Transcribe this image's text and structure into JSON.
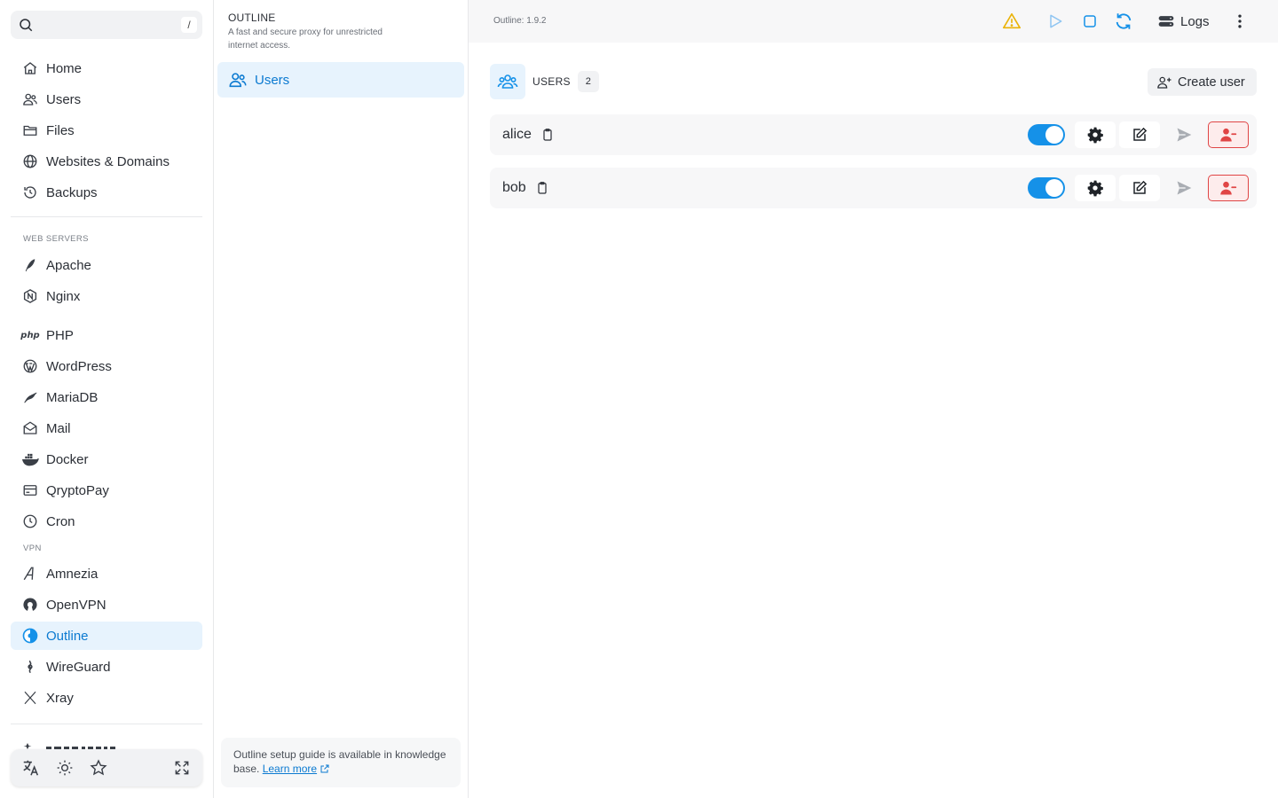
{
  "search": {
    "shortcut": "/"
  },
  "sidebar": {
    "main_items": [
      {
        "label": "Home",
        "icon": "home-icon"
      },
      {
        "label": "Users",
        "icon": "users-icon"
      },
      {
        "label": "Files",
        "icon": "folder-icon"
      },
      {
        "label": "Websites & Domains",
        "icon": "globe-icon"
      },
      {
        "label": "Backups",
        "icon": "history-icon"
      }
    ],
    "section_web_servers": "WEB SERVERS",
    "web_items": [
      {
        "label": "Apache",
        "icon": "apache-feather-icon"
      },
      {
        "label": "Nginx",
        "icon": "nginx-icon"
      },
      {
        "label": "PHP",
        "icon": "php-icon",
        "glyph": "php"
      },
      {
        "label": "WordPress",
        "icon": "wordpress-icon"
      },
      {
        "label": "MariaDB",
        "icon": "mariadb-icon"
      },
      {
        "label": "Mail",
        "icon": "mail-icon"
      },
      {
        "label": "Docker",
        "icon": "docker-icon"
      },
      {
        "label": "QryptoPay",
        "icon": "payment-card-icon"
      },
      {
        "label": "Cron",
        "icon": "clock-icon"
      }
    ],
    "section_vpn": "VPN",
    "vpn_items": [
      {
        "label": "Amnezia",
        "icon": "amnezia-icon"
      },
      {
        "label": "OpenVPN",
        "icon": "openvpn-icon"
      },
      {
        "label": "Outline",
        "icon": "outline-icon",
        "active": true
      },
      {
        "label": "WireGuard",
        "icon": "wireguard-icon"
      },
      {
        "label": "Xray",
        "icon": "xray-icon"
      }
    ],
    "bottom_icons": [
      "translate-icon",
      "theme-sun-icon",
      "favorite-star-icon",
      "fullscreen-icon"
    ]
  },
  "app_panel": {
    "title": "OUTLINE",
    "description": "A fast and secure proxy for unrestricted internet access.",
    "menu_users": "Users",
    "guide_text": "Outline setup guide is available in knowledge base.",
    "guide_link": "Learn more"
  },
  "topbar": {
    "version": "Outline: 1.9.2",
    "logs_label": "Logs"
  },
  "users": {
    "title": "USERS",
    "count": "2",
    "create_label": "Create user",
    "list": [
      {
        "name": "alice",
        "enabled": true
      },
      {
        "name": "bob",
        "enabled": true
      }
    ]
  },
  "colors": {
    "accent": "#1591e8",
    "active_bg": "#e7f3fd",
    "danger": "#e04545",
    "warning": "#eab308"
  }
}
